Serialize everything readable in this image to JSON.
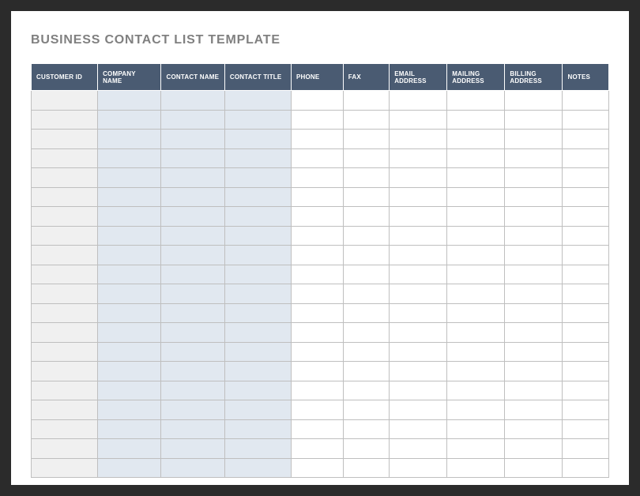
{
  "title": "BUSINESS CONTACT LIST TEMPLATE",
  "columns": [
    "CUSTOMER ID",
    "COMPANY NAME",
    "CONTACT NAME",
    "CONTACT TITLE",
    "PHONE",
    "FAX",
    "EMAIL ADDRESS",
    "MAILING ADDRESS",
    "BILLING ADDRESS",
    "NOTES"
  ],
  "rows": [
    [
      "",
      "",
      "",
      "",
      "",
      "",
      "",
      "",
      "",
      ""
    ],
    [
      "",
      "",
      "",
      "",
      "",
      "",
      "",
      "",
      "",
      ""
    ],
    [
      "",
      "",
      "",
      "",
      "",
      "",
      "",
      "",
      "",
      ""
    ],
    [
      "",
      "",
      "",
      "",
      "",
      "",
      "",
      "",
      "",
      ""
    ],
    [
      "",
      "",
      "",
      "",
      "",
      "",
      "",
      "",
      "",
      ""
    ],
    [
      "",
      "",
      "",
      "",
      "",
      "",
      "",
      "",
      "",
      ""
    ],
    [
      "",
      "",
      "",
      "",
      "",
      "",
      "",
      "",
      "",
      ""
    ],
    [
      "",
      "",
      "",
      "",
      "",
      "",
      "",
      "",
      "",
      ""
    ],
    [
      "",
      "",
      "",
      "",
      "",
      "",
      "",
      "",
      "",
      ""
    ],
    [
      "",
      "",
      "",
      "",
      "",
      "",
      "",
      "",
      "",
      ""
    ],
    [
      "",
      "",
      "",
      "",
      "",
      "",
      "",
      "",
      "",
      ""
    ],
    [
      "",
      "",
      "",
      "",
      "",
      "",
      "",
      "",
      "",
      ""
    ],
    [
      "",
      "",
      "",
      "",
      "",
      "",
      "",
      "",
      "",
      ""
    ],
    [
      "",
      "",
      "",
      "",
      "",
      "",
      "",
      "",
      "",
      ""
    ],
    [
      "",
      "",
      "",
      "",
      "",
      "",
      "",
      "",
      "",
      ""
    ],
    [
      "",
      "",
      "",
      "",
      "",
      "",
      "",
      "",
      "",
      ""
    ],
    [
      "",
      "",
      "",
      "",
      "",
      "",
      "",
      "",
      "",
      ""
    ],
    [
      "",
      "",
      "",
      "",
      "",
      "",
      "",
      "",
      "",
      ""
    ],
    [
      "",
      "",
      "",
      "",
      "",
      "",
      "",
      "",
      "",
      ""
    ],
    [
      "",
      "",
      "",
      "",
      "",
      "",
      "",
      "",
      "",
      ""
    ]
  ],
  "colors": {
    "header_bg": "#4a5b72",
    "id_col_bg": "#f0f0f0",
    "shaded_col_bg": "#e1e8f0",
    "border": "#bfbfbf",
    "title_text": "#808080"
  }
}
